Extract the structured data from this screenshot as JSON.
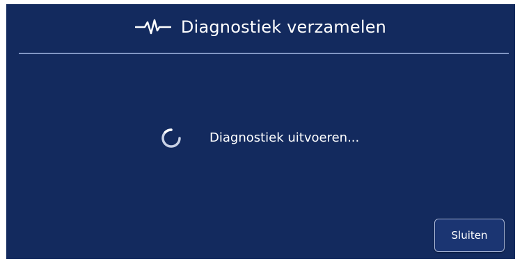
{
  "dialog": {
    "title": "Diagnostiek verzamelen",
    "title_icon": "pulse-icon",
    "status_icon": "spinner-icon",
    "status_text": "Diagnostiek uitvoeren...",
    "close_label": "Sluiten"
  },
  "colors": {
    "background": "#132a5e",
    "divider": "#8196c4",
    "button_border": "#a9b6d6",
    "text": "#ffffff"
  }
}
